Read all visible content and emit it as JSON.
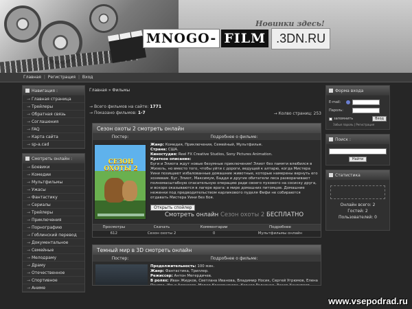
{
  "header": {
    "slogan": "Новинки здесь!",
    "logo_mnogo": "MNOGO-",
    "logo_film": "FILM",
    "logo_domain": ".3DN.RU"
  },
  "topnav": {
    "items": [
      "Главная",
      "Регистрация",
      "Вход"
    ],
    "sep": "|"
  },
  "left": {
    "nav_title": "Навигация :",
    "nav_items": [
      "Главная страница",
      "Трейлеры",
      "Обратная связь",
      "Соглашения",
      "FAQ",
      "Карта сайта",
      "sp-a.cad"
    ],
    "watch_title": "Смотреть онлайн :",
    "watch_items": [
      "Боевики",
      "Комедии",
      "Мультфильмы",
      "Ужасы",
      "Фантастику",
      "Сериалы",
      "Трейлеры",
      "Приключения",
      "Порнографию",
      "Гоблинский перевод",
      "Документальное",
      "Семейные",
      "Мелодраму",
      "Драму",
      "Отечественное",
      "Спортивное",
      "Аниме"
    ]
  },
  "right": {
    "login_title": "Форма входа",
    "email_label": "E-mail:",
    "password_label": "Пароль:",
    "login_button": "Вход",
    "remember_label": "запомнить",
    "forgot_links": "Забыл пароль | Регистрация",
    "search_title": "Поиск :",
    "search_button": "Найти",
    "stats_title": "Статистика",
    "stats_lines": [
      "Онлайн всего: 2",
      "Гостей: 2",
      "Пользователей: 0"
    ]
  },
  "center": {
    "breadcrumbs": "Главная » Фильмы",
    "total_label": "Всего фильмов на сайте:",
    "total_value": "1771",
    "shown_label": "Показано фильмов:",
    "shown_value": "1-7",
    "pages_label": "Колво страниц: 253"
  },
  "movie1": {
    "title": "Сезон охоты 2 смотреть онлайн",
    "poster_header": "Постер:",
    "about_header": "Подробнее о фильме:",
    "poster_title": "СЕЗОН ОХОТЫ 2",
    "genre_label": "Жанр:",
    "genre": "Комедия, Приключения, Семейный, Мультфильм.",
    "country_label": "Страна:",
    "country": "США.",
    "studio_label": "Киностудия:",
    "studio": "Reel FX Creative Studios, Sony Pictures Animation.",
    "summary_label": "Краткое описание:",
    "summary": "Буги и Элиота ждут новые безумные приключения! Элиот без памяти влюбился в Жизель, но вместо того, чтобы уйти с дороги, ведущей к алтарю, когда Мистера Уини похищают избалованные домашние животные, которые намерены вернуть его хозяевам. Буг, Элиот, Максимум, Бадди и другие обитатели леса разворачивают полномасштабную спасательную операцию ради своего пухового на сосиску друга, и вскоре оказываются в лагере врага: в мире домашних питомцев. Домашние неженки под предводительством карликового пуделя Фифи не собираются отдавать Мистера Уини без боя.",
    "spoiler_button": "Открыть спойлер",
    "watch_prefix": "Смотреть онлайн ",
    "watch_highlight": "Сезон охоты 2",
    "watch_suffix": " БЕСПЛАТНО",
    "table_headers": [
      "Просмотры",
      "Скачать",
      "Комментарии",
      "Подробнее"
    ],
    "table_values": [
      "612",
      "Сезон охоты 2",
      "0",
      "Мультфильмы онлайн"
    ]
  },
  "movie2": {
    "title": "Темный мир в 3D смотреть онлайн",
    "poster_header": "Постер:",
    "about_header": "Подробнее о фильме:",
    "duration_label": "Продолжительность:",
    "duration": "100 мин.",
    "genre_label": "Жанр:",
    "genre": "Фантастика, Триллер.",
    "director_label": "Режиссер:",
    "director": "Антон Мегердичев.",
    "cast_label": "В ролях:",
    "cast": "Иван Жидков, Светлана Иванова, Владимир Носик, Сергей Угрюмов, Елена Панова, Илья Алексеев, Мария Кожевникова, Ксения Радченко, Захар Хунгуреев."
  },
  "watermark": "www.vsepodrad.ru"
}
